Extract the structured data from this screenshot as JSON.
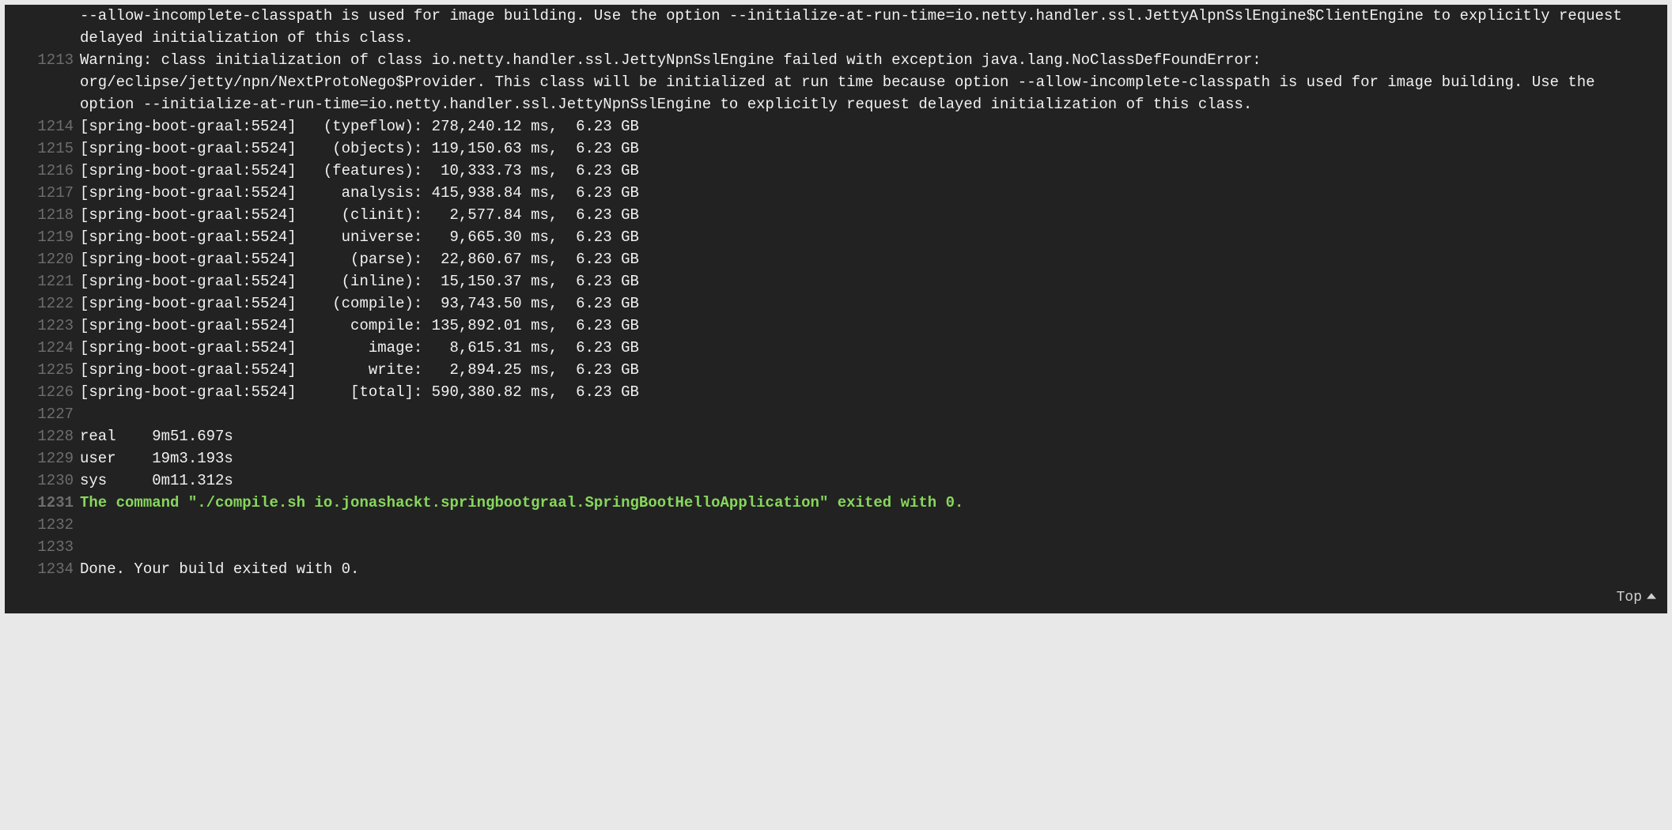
{
  "footer": {
    "top_label": "Top"
  },
  "lines": [
    {
      "n": "",
      "text": "--allow-incomplete-classpath is used for image building. Use the option --initialize-at-run-time=io.netty.handler.ssl.JettyAlpnSslEngine$ClientEngine to explicitly request delayed initialization of this class.",
      "cls": ""
    },
    {
      "n": "1213",
      "text": "Warning: class initialization of class io.netty.handler.ssl.JettyNpnSslEngine failed with exception java.lang.NoClassDefFoundError: org/eclipse/jetty/npn/NextProtoNego$Provider. This class will be initialized at run time because option --allow-incomplete-classpath is used for image building. Use the option --initialize-at-run-time=io.netty.handler.ssl.JettyNpnSslEngine to explicitly request delayed initialization of this class.",
      "cls": ""
    },
    {
      "n": "1214",
      "text": "[spring-boot-graal:5524]   (typeflow): 278,240.12 ms,  6.23 GB",
      "cls": ""
    },
    {
      "n": "1215",
      "text": "[spring-boot-graal:5524]    (objects): 119,150.63 ms,  6.23 GB",
      "cls": ""
    },
    {
      "n": "1216",
      "text": "[spring-boot-graal:5524]   (features):  10,333.73 ms,  6.23 GB",
      "cls": ""
    },
    {
      "n": "1217",
      "text": "[spring-boot-graal:5524]     analysis: 415,938.84 ms,  6.23 GB",
      "cls": ""
    },
    {
      "n": "1218",
      "text": "[spring-boot-graal:5524]     (clinit):   2,577.84 ms,  6.23 GB",
      "cls": ""
    },
    {
      "n": "1219",
      "text": "[spring-boot-graal:5524]     universe:   9,665.30 ms,  6.23 GB",
      "cls": ""
    },
    {
      "n": "1220",
      "text": "[spring-boot-graal:5524]      (parse):  22,860.67 ms,  6.23 GB",
      "cls": ""
    },
    {
      "n": "1221",
      "text": "[spring-boot-graal:5524]     (inline):  15,150.37 ms,  6.23 GB",
      "cls": ""
    },
    {
      "n": "1222",
      "text": "[spring-boot-graal:5524]    (compile):  93,743.50 ms,  6.23 GB",
      "cls": ""
    },
    {
      "n": "1223",
      "text": "[spring-boot-graal:5524]      compile: 135,892.01 ms,  6.23 GB",
      "cls": ""
    },
    {
      "n": "1224",
      "text": "[spring-boot-graal:5524]        image:   8,615.31 ms,  6.23 GB",
      "cls": ""
    },
    {
      "n": "1225",
      "text": "[spring-boot-graal:5524]        write:   2,894.25 ms,  6.23 GB",
      "cls": ""
    },
    {
      "n": "1226",
      "text": "[spring-boot-graal:5524]      [total]: 590,380.82 ms,  6.23 GB",
      "cls": ""
    },
    {
      "n": "1227",
      "text": "",
      "cls": ""
    },
    {
      "n": "1228",
      "text": "real    9m51.697s",
      "cls": ""
    },
    {
      "n": "1229",
      "text": "user    19m3.193s",
      "cls": ""
    },
    {
      "n": "1230",
      "text": "sys     0m11.312s",
      "cls": ""
    },
    {
      "n": "1231",
      "text": "The command \"./compile.sh io.jonashackt.springbootgraal.SpringBootHelloApplication\" exited with 0.",
      "cls": "green"
    },
    {
      "n": "1232",
      "text": "",
      "cls": ""
    },
    {
      "n": "1233",
      "text": "",
      "cls": ""
    },
    {
      "n": "1234",
      "text": "Done. Your build exited with 0.",
      "cls": ""
    }
  ]
}
